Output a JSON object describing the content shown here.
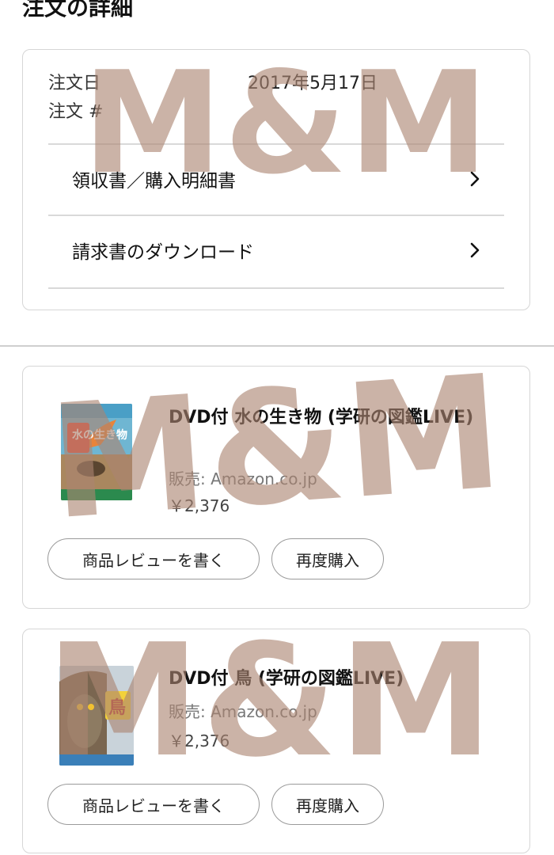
{
  "page": {
    "title": "注文の詳細"
  },
  "order_summary": {
    "date_label": "注文日",
    "date_value": "2017年5月17日",
    "number_label": "注文 #",
    "links": [
      {
        "label": "領収書／購入明細書",
        "icon": "chevron-right-icon"
      },
      {
        "label": "請求書のダウンロード",
        "icon": "chevron-right-icon"
      }
    ]
  },
  "items": [
    {
      "title": "DVD付 水の生き物 (学研の図鑑LIVE)",
      "seller": "販売: Amazon.co.jp",
      "price": "￥2,376",
      "cover_text": "水の生き物",
      "review_button": "商品レビューを書く",
      "rebuy_button": "再度購入"
    },
    {
      "title": "DVD付 鳥 (学研の図鑑LIVE)",
      "seller": "販売: Amazon.co.jp",
      "price": "￥2,376",
      "cover_text": "鳥",
      "review_button": "商品レビューを書く",
      "rebuy_button": "再度購入"
    }
  ],
  "watermark": {
    "text": "M&M",
    "color": "#ab8571"
  }
}
